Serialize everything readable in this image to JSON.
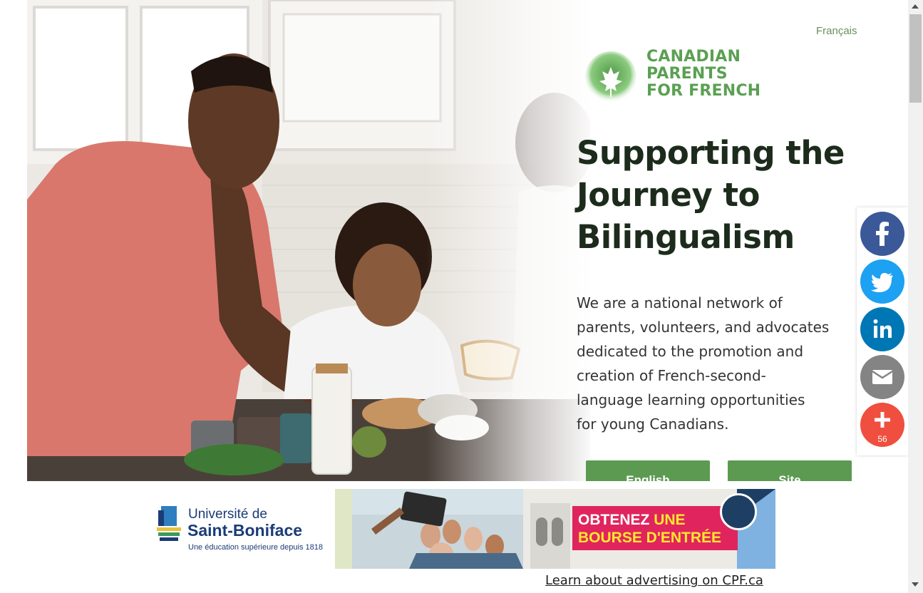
{
  "header": {
    "language_link": "Français"
  },
  "logo": {
    "line1": "CANADIAN",
    "line2": "PARENTS",
    "line3": "FOR FRENCH",
    "icon": "maple-leaf-icon",
    "color": "#5aa052"
  },
  "hero": {
    "headline_line1": "Supporting the",
    "headline_line2": "Journey to",
    "headline_line3": "Bilingualism",
    "description_lines": [
      "We are a national network of",
      "parents, volunteers, and advocates",
      "dedicated to the promotion and",
      "creation of French-second-",
      "language learning opportunities",
      "for young Canadians."
    ],
    "buttons": [
      {
        "label": "English"
      },
      {
        "label": "Site"
      }
    ],
    "button_color": "#5c9a52",
    "image": "photo-father-and-child-in-kitchen"
  },
  "ad": {
    "advertiser_line1": "Université de",
    "advertiser_line2": "Saint-Boniface",
    "advertiser_tagline": "Une éducation supérieure depuis 1818",
    "cta_part1": "OBTENEZ",
    "cta_highlight": "UNE",
    "cta_part2": "BOURSE D'ENTRÉE",
    "cta_color": "#e0245e",
    "footer_link": "Learn about advertising on CPF.ca"
  },
  "share": {
    "buttons": [
      {
        "name": "facebook",
        "icon": "facebook-icon",
        "color": "#3b5998"
      },
      {
        "name": "twitter",
        "icon": "twitter-icon",
        "color": "#1da1f2"
      },
      {
        "name": "linkedin",
        "icon": "linkedin-icon",
        "color": "#0077b5"
      },
      {
        "name": "email",
        "icon": "email-icon",
        "color": "#848484"
      },
      {
        "name": "more",
        "icon": "plus-icon",
        "color": "#f04e3e"
      }
    ],
    "count": "56"
  }
}
